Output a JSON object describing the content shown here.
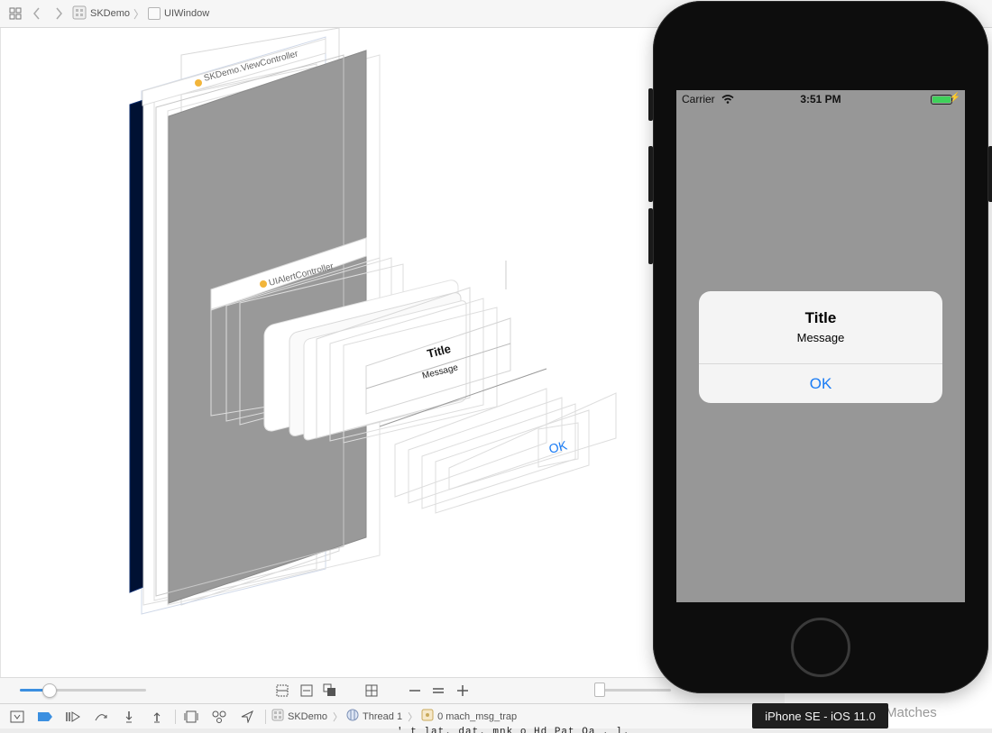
{
  "jumpbar": {
    "items": [
      {
        "label": "SKDemo",
        "icon": "project-icon"
      },
      {
        "label": "UIWindow",
        "icon": "view-icon"
      }
    ]
  },
  "hierarchy": {
    "view_controller_label": "SKDemo.ViewController",
    "alert_controller_label": "UIAlertController",
    "alert_title": "Title",
    "alert_message": "Message",
    "ok_label": "OK"
  },
  "debugbar": {
    "items": [
      {
        "label": "SKDemo",
        "icon": "project-icon"
      },
      {
        "label": "Thread 1",
        "icon": "thread-icon"
      },
      {
        "label": "0 mach_msg_trap",
        "icon": "frame-icon"
      }
    ]
  },
  "filter_placeholder_fragment": "Matches",
  "console_peek": "' t lat. dat. mnk o Hd Pat Oa . l.",
  "simulator": {
    "status": {
      "carrier": "Carrier",
      "time": "3:51 PM"
    },
    "alert": {
      "title": "Title",
      "message": "Message",
      "button": "OK"
    },
    "device_label": "iPhone SE - iOS 11.0"
  },
  "colors": {
    "accent": "#1a7cf5",
    "battery": "#3fd15a",
    "screen_dim": "#979797",
    "window_layer": "#001133"
  }
}
